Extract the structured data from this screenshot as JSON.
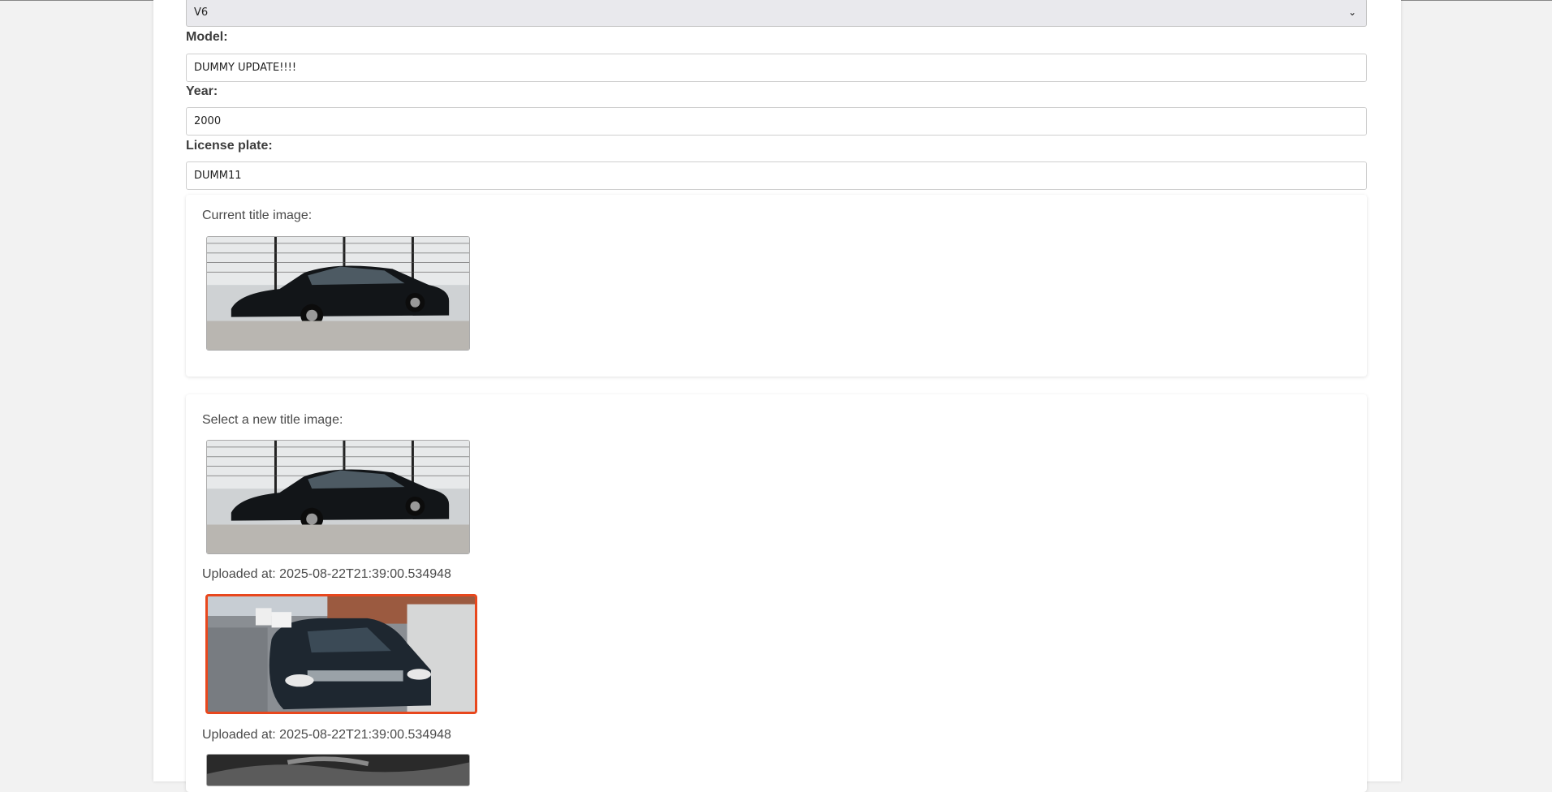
{
  "form": {
    "engine_select": {
      "value": "V6"
    },
    "model": {
      "label": "Model:",
      "value": "DUMMY UPDATE!!!!"
    },
    "year": {
      "label": "Year:",
      "value": "2000"
    },
    "license_plate": {
      "label": "License plate:",
      "value": "DUMM11"
    }
  },
  "current_image": {
    "title": "Current title image:"
  },
  "gallery": {
    "title": "Select a new title image:",
    "items": [
      {
        "caption": "Uploaded at: 2025-08-22T21:39:00.534948",
        "selected": false
      },
      {
        "caption": "Uploaded at: 2025-08-22T21:39:00.534948",
        "selected": true
      }
    ]
  },
  "colors": {
    "selection_border": "#e8471d"
  }
}
